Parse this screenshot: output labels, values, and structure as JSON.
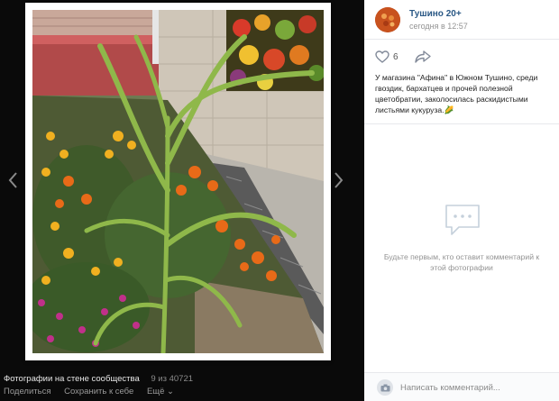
{
  "viewer": {
    "album_title": "Фотографии на стене сообщества",
    "counter": "9 из 40721",
    "share_label": "Поделиться",
    "save_label": "Сохранить к себе",
    "more_label": "Ещё ⌄",
    "prev_icon": "chevron-left-icon",
    "next_icon": "chevron-right-icon"
  },
  "post": {
    "group_name": "Тушино 20+",
    "date": "сегодня в 12:57",
    "likes": "6",
    "description": "У магазина \"Афина\" в Южном Тушино, среди гвоздик, бархатцев и прочей полезной цветобратии, заколосилась раскидистыми листьями кукуруза.🌽"
  },
  "comments": {
    "empty_text": "Будьте первым, кто оставит комментарий к этой фотографии",
    "input_placeholder": "Написать комментарий..."
  },
  "colors": {
    "link": "#2a5885",
    "muted": "#939393",
    "icon": "#828a99"
  }
}
